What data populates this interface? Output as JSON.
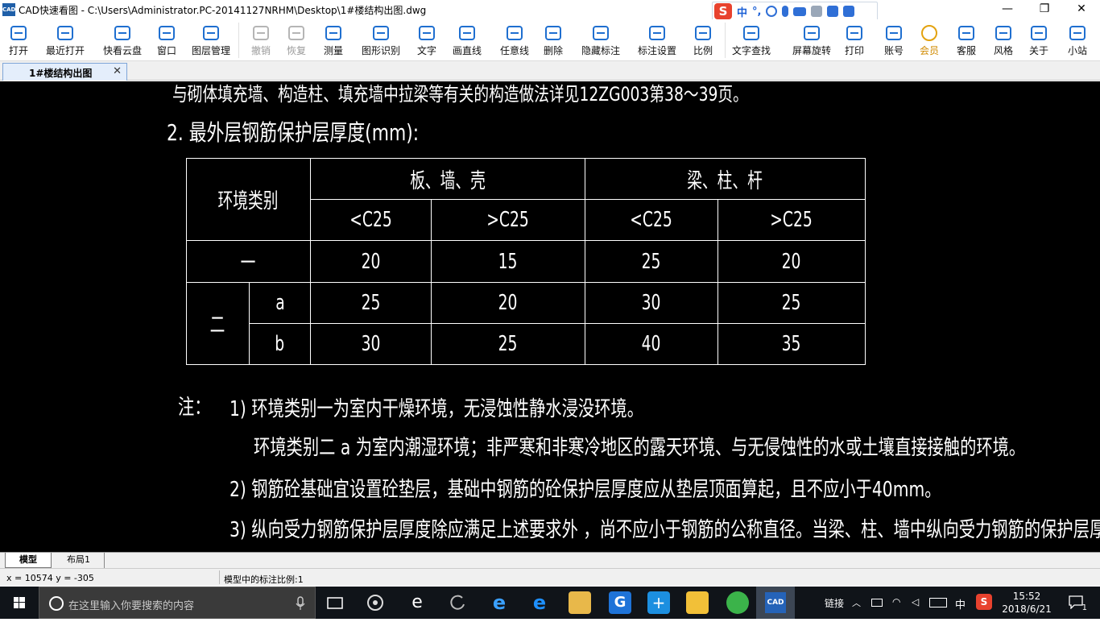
{
  "window": {
    "app_icon": "CAD",
    "title": "CAD快速看图 - C:\\Users\\Administrator.PC-20141127NRHM\\Desktop\\1#楼结构出图.dwg",
    "min": "—",
    "max": "❐",
    "close": "✕"
  },
  "ime": {
    "logo": "S",
    "lang": "中",
    "punct": "°,"
  },
  "toolbar": [
    {
      "id": "open",
      "label": "打开",
      "icon": "folder-open-icon"
    },
    {
      "id": "recent",
      "label": "最近打开",
      "icon": "history-icon"
    },
    {
      "id": "cloud",
      "label": "快看云盘",
      "icon": "cloud-icon"
    },
    {
      "id": "window",
      "label": "窗口",
      "icon": "window-icon"
    },
    {
      "id": "layers",
      "label": "图层管理",
      "icon": "layers-icon"
    },
    {
      "id": "undo",
      "label": "撤销",
      "icon": "undo-icon",
      "disabled": true
    },
    {
      "id": "redo",
      "label": "恢复",
      "icon": "redo-icon",
      "disabled": true
    },
    {
      "id": "measure",
      "label": "测量",
      "icon": "ruler-icon"
    },
    {
      "id": "recognize",
      "label": "图形识别",
      "icon": "shape-recognize-icon"
    },
    {
      "id": "text",
      "label": "文字",
      "icon": "text-icon"
    },
    {
      "id": "line",
      "label": "画直线",
      "icon": "line-icon"
    },
    {
      "id": "freeline",
      "label": "任意线",
      "icon": "pen-icon"
    },
    {
      "id": "delete",
      "label": "删除",
      "icon": "eraser-icon"
    },
    {
      "id": "hide",
      "label": "隐藏标注",
      "icon": "eye-hide-icon"
    },
    {
      "id": "dimset",
      "label": "标注设置",
      "icon": "settings-icon"
    },
    {
      "id": "scale",
      "label": "比例",
      "icon": "scale-icon"
    },
    {
      "id": "findtext",
      "label": "文字查找",
      "icon": "find-text-icon"
    },
    {
      "id": "rotate",
      "label": "屏幕旋转",
      "icon": "rotate-screen-icon"
    },
    {
      "id": "print",
      "label": "打印",
      "icon": "printer-icon"
    },
    {
      "id": "account",
      "label": "账号",
      "icon": "user-icon"
    },
    {
      "id": "vip",
      "label": "会员",
      "icon": "vip-icon",
      "gold": true
    },
    {
      "id": "service",
      "label": "客服",
      "icon": "headset-icon"
    },
    {
      "id": "style",
      "label": "风格",
      "icon": "style-icon"
    },
    {
      "id": "about",
      "label": "关于",
      "icon": "info-icon"
    },
    {
      "id": "station",
      "label": "小站",
      "icon": "k-logo-icon"
    }
  ],
  "doc_tab": {
    "title": "1#楼结构出图",
    "close": "✕"
  },
  "drawing": {
    "line_top": "与砌体填充墙、构造柱、填充墙中拉梁等有关的构造做法详见12ZG003第38～39页。",
    "heading": "2. 最外层钢筋保护层厚度(mm):",
    "table": {
      "env_header": "环境类别",
      "group1": "板、墙、壳",
      "group2": "梁、柱、杆",
      "sub": [
        "<C25",
        ">C25",
        "<C25",
        ">C25"
      ],
      "rows": [
        {
          "cls": "一",
          "sub": "",
          "vals": [
            "20",
            "15",
            "25",
            "20"
          ]
        },
        {
          "cls": "二",
          "sub": "a",
          "vals": [
            "25",
            "20",
            "30",
            "25"
          ]
        },
        {
          "cls": "二",
          "sub": "b",
          "vals": [
            "30",
            "25",
            "40",
            "35"
          ]
        }
      ]
    },
    "note_label": "注：",
    "notes": [
      "1)  环境类别一为室内干燥环境，无浸蚀性静水浸没环境。",
      "环境类别二 a 为室内潮湿环境；非严寒和非寒冷地区的露天环境、与无侵蚀性的水或土壤直接接触的环境。",
      "2)  钢筋砼基础宜设置砼垫层，基础中钢筋的砼保护层厚度应从垫层顶面算起，且不应小于40mm。",
      "3)  纵向受力钢筋保护层厚度除应满足上述要求外 ，尚不应小于钢筋的公称直径。当梁、柱、墙中纵向受力钢筋的保护层厚度"
    ]
  },
  "layout_tabs": [
    "模型",
    "布局1"
  ],
  "status": {
    "coords": "x = 10574  y = -305",
    "scale": "模型中的标注比例:1"
  },
  "taskbar": {
    "search_placeholder": "在这里输入你要搜索的内容",
    "tray_link": "链接",
    "ime": "中",
    "time": "15:52",
    "date": "2018/6/21",
    "notify_count": "1"
  }
}
